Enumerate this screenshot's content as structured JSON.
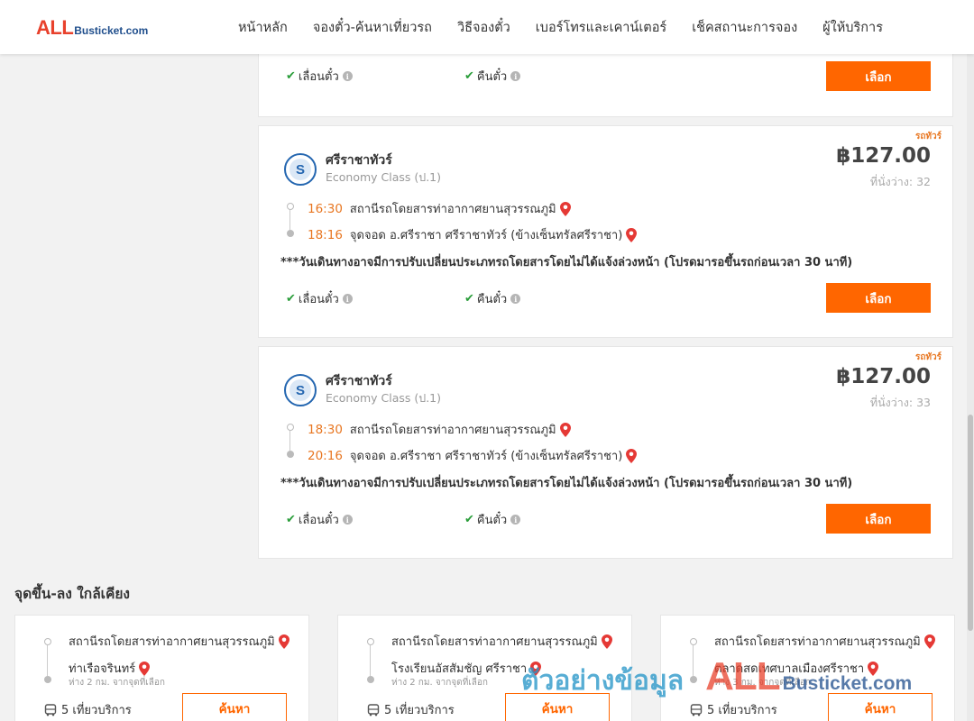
{
  "header": {
    "logo_all": "ALL",
    "logo_rest": "Busticket.com",
    "nav": [
      "หน้าหลัก",
      "จองตั๋ว-ค้นหาเที่ยวรถ",
      "วิธีจองตั๋ว",
      "เบอร์โทรและเคาน์เตอร์",
      "เช็คสถานะการจอง",
      "ผู้ให้บริการ"
    ]
  },
  "top_card": {
    "features": [
      "เลื่อนตั๋ว",
      "คืนตั๋ว"
    ],
    "button": "เลือก"
  },
  "trips": [
    {
      "tag": "รถทัวร์",
      "operator": "ศรีราชาทัวร์",
      "class": "Economy Class (ป.1)",
      "logo_letter": "S",
      "price": "฿127.00",
      "seats": "ที่นั่งว่าง: 32",
      "depart_time": "16:30",
      "depart_place": "สถานีรถโดยสารท่าอากาศยานสุวรรณภูมิ",
      "arrive_time": "18:16",
      "arrive_place": "จุดจอด อ.ศรีราชา ศรีราชาทัวร์ (ข้างเซ็นทรัลศรีราชา)",
      "note": "***วันเดินทางอาจมีการปรับเปลี่ยนประเภทรถโดยสารโดยไม่ได้แจ้งล่วงหน้า (โปรดมารอขึ้นรถก่อนเวลา 30 นาที)",
      "features": [
        "เลื่อนตั๋ว",
        "คืนตั๋ว"
      ],
      "button": "เลือก"
    },
    {
      "tag": "รถทัวร์",
      "operator": "ศรีราชาทัวร์",
      "class": "Economy Class (ป.1)",
      "logo_letter": "S",
      "price": "฿127.00",
      "seats": "ที่นั่งว่าง: 33",
      "depart_time": "18:30",
      "depart_place": "สถานีรถโดยสารท่าอากาศยานสุวรรณภูมิ",
      "arrive_time": "20:16",
      "arrive_place": "จุดจอด อ.ศรีราชา ศรีราชาทัวร์ (ข้างเซ็นทรัลศรีราชา)",
      "note": "***วันเดินทางอาจมีการปรับเปลี่ยนประเภทรถโดยสารโดยไม่ได้แจ้งล่วงหน้า (โปรดมารอขึ้นรถก่อนเวลา 30 นาที)",
      "features": [
        "เลื่อนตั๋ว",
        "คืนตั๋ว"
      ],
      "button": "เลือก"
    }
  ],
  "nearby": {
    "title": "จุดขึ้น-ลง ใกล้เคียง",
    "cards": [
      {
        "from": "สถานีรถโดยสารท่าอากาศยานสุวรรณภูมิ",
        "to": "ท่าเรือจรินทร์",
        "distance": "ห่าง 2 กม. จากจุดที่เลือก",
        "trips": "5 เที่ยวบริการ",
        "button": "ค้นหา"
      },
      {
        "from": "สถานีรถโดยสารท่าอากาศยานสุวรรณภูมิ",
        "to": "โรงเรียนอัสสัมชัญ ศรีราชา",
        "distance": "ห่าง 2 กม. จากจุดที่เลือก",
        "trips": "5 เที่ยวบริการ",
        "button": "ค้นหา"
      },
      {
        "from": "สถานีรถโดยสารท่าอากาศยานสุวรรณภูมิ",
        "to": "ตลาดสดเทศบาลเมืองศรีราชา",
        "distance": "ห่าง 3 กม. จากจุดที่เลือก",
        "trips": "5 เที่ยวบริการ",
        "button": "ค้นหา"
      }
    ]
  },
  "watermark": {
    "text": "ตัวอย่างข้อมูล",
    "logo_all": "ALL",
    "logo_rest": "Busticket.com"
  },
  "colors": {
    "accent": "#ff6600",
    "time": "#e87722",
    "check": "#2a9d3a",
    "pin": "#e53935",
    "logo_red": "#e8412c",
    "logo_blue": "#1f4e8c"
  }
}
